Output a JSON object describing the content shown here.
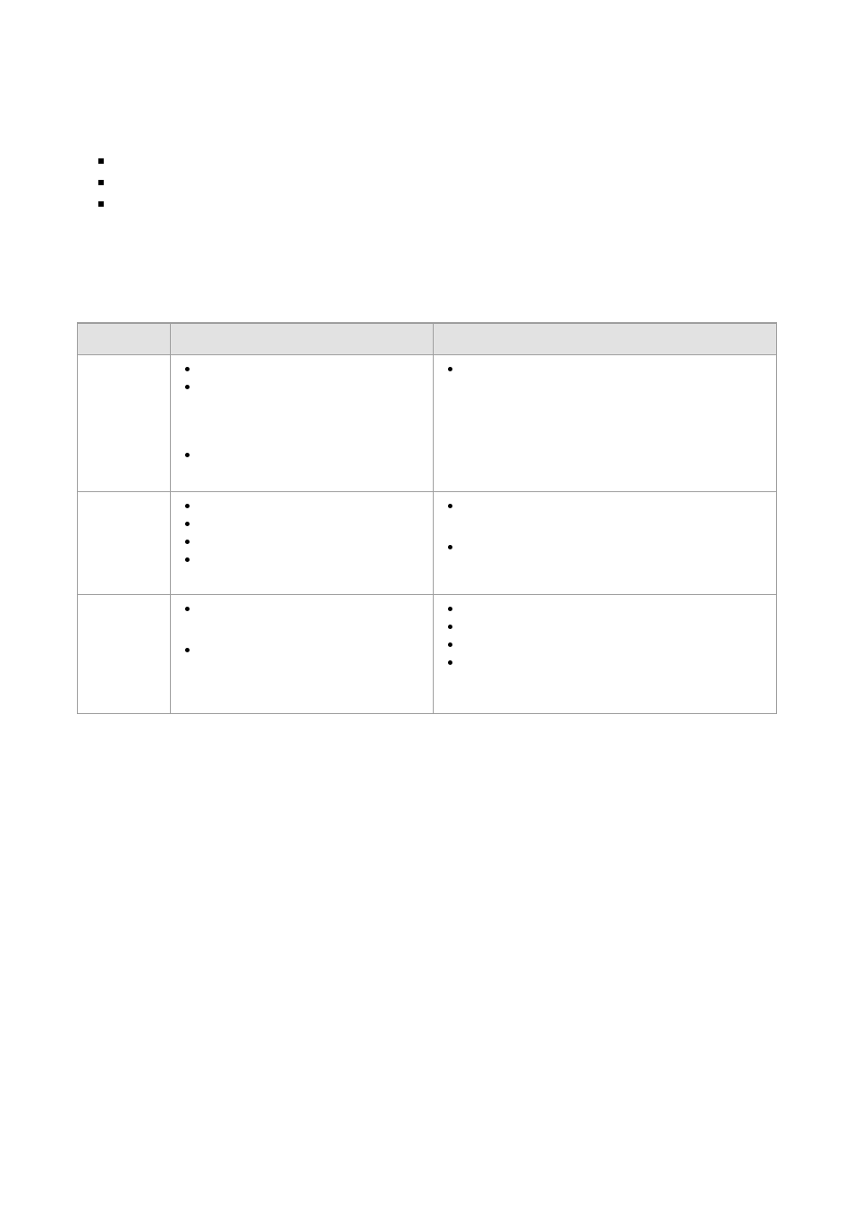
{
  "top_list": {
    "items": [
      {
        "text": ""
      },
      {
        "text": ""
      },
      {
        "text": ""
      }
    ]
  },
  "table": {
    "headers": {
      "c1": "",
      "c2": "",
      "c3": ""
    },
    "rows": [
      {
        "c1": "",
        "c2_items": [
          {
            "text": ""
          },
          {
            "text": ""
          },
          {
            "text": ""
          }
        ],
        "c2_gap_after_index": 1,
        "c3_items": [
          {
            "text": ""
          }
        ]
      },
      {
        "c1": "",
        "c2_items": [
          {
            "text": ""
          },
          {
            "text": ""
          },
          {
            "text": ""
          },
          {
            "text": ""
          }
        ],
        "c3_items": [
          {
            "text": ""
          },
          {
            "text": ""
          }
        ],
        "c3_gap_after_index": 0
      },
      {
        "c1": "",
        "c2_items": [
          {
            "text": ""
          },
          {
            "text": ""
          }
        ],
        "c2_gap_after_index": 0,
        "c3_items": [
          {
            "text": ""
          },
          {
            "text": ""
          },
          {
            "text": ""
          },
          {
            "text": ""
          }
        ]
      }
    ]
  }
}
